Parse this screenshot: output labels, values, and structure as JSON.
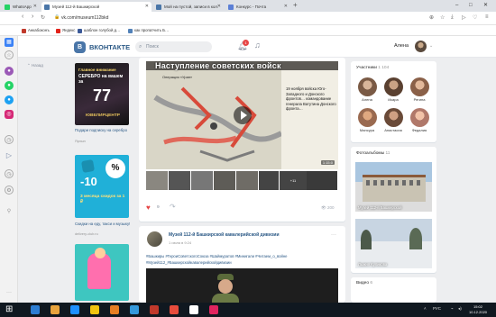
{
  "browser": {
    "tabs": [
      {
        "label": "WhatsApp",
        "icon": "whatsapp-icon",
        "color": "#25d366"
      },
      {
        "label": "Музей 112-й Башкирской",
        "icon": "vk-icon",
        "color": "#4a76a8"
      },
      {
        "label": "Мой на пустой, записи в кол.",
        "icon": "vk-icon",
        "color": "#4a76a8"
      },
      {
        "label": "Конкурс - Почта",
        "icon": "mail-icon",
        "color": "#5b7fd6"
      }
    ],
    "new_tab": "+",
    "window_controls": [
      "–",
      "□",
      "✕"
    ],
    "url": "vk.com/museum112bkd",
    "bookmarks": [
      {
        "label": "Анкабоконъ",
        "color": "#c0392b"
      },
      {
        "label": "Яндекс",
        "color": "#e2231a"
      },
      {
        "label": "шаблон голубой д…",
        "color": "#3b5998"
      },
      {
        "label": "как пропатчить Б…",
        "color": "#5181b8"
      }
    ]
  },
  "vk": {
    "logo_letter": "В",
    "brand": "ВКОНТАКТЕ",
    "search_placeholder": "Поиск",
    "notifications_count": "1",
    "user_name": "Алена",
    "back_link": "Назад"
  },
  "ads": [
    {
      "title": "Подари подписку на серебро",
      "sub": "Ярлын",
      "headline": "Главное внимание",
      "subhead": "СЕРЕБРО на вашем за",
      "price": "77",
      "brand": "ЮВЕЛИРЦЕНТР"
    },
    {
      "title": "3 месяца скидок за 1 ₽",
      "sub": "",
      "headline": "-10",
      "percent": "%"
    },
    {
      "title": "Скидки на еду, такси и музыку!",
      "sub": "delivery-club.ru"
    }
  ],
  "post1": {
    "video_title": "Наступление советских войск",
    "map_label": "Операция «Уран»",
    "video_text": "19 ноября войска Юго-Западного и Донского фронтов… командование генерала Ватутина Донского фронта…",
    "duration": "1:15:0",
    "more_count": "+11",
    "likes": "9",
    "views": "200"
  },
  "post2": {
    "author": "Музей 112-й Башкирской кавалерийской дивизии",
    "time": "1 июля в 9:24",
    "tags": "#Башкиры #ГероиСоветскогоСоюза #Шаймуратов #Минигали #Читаем_о_войне #Музей112_#Башкирскойкавалерийскойдивизии",
    "more": "···"
  },
  "members": {
    "header": "Участники",
    "count": "1 104",
    "people": [
      {
        "name": "Алена",
        "color": "#7a5a45"
      },
      {
        "name": "Икара",
        "color": "#5a4030"
      },
      {
        "name": "Регина",
        "color": "#8a6048"
      },
      {
        "name": "Мансура",
        "color": "#9a6a50"
      },
      {
        "name": "Анастасия",
        "color": "#6a4a38"
      },
      {
        "name": "Федалия",
        "color": "#b0786a"
      }
    ]
  },
  "albums": {
    "header": "Фотоальбомы",
    "count": "11",
    "items": [
      {
        "caption": "Музей 112-й Башкирской",
        "count": "11"
      },
      {
        "caption": "Лыжня Куликова",
        "count": ""
      }
    ]
  },
  "video_block": {
    "header": "Видео",
    "count": "6"
  },
  "taskbar": {
    "time": "15:02",
    "date": "10.12.2020",
    "lang": "РУС",
    "apps": [
      "#2d7dd2",
      "#e8a33d",
      "#1e90ff",
      "#f1c40f",
      "#e67e22",
      "#3498db",
      "#c0392b",
      "#e74c3c",
      "#ffffff",
      "#e0245e"
    ]
  }
}
